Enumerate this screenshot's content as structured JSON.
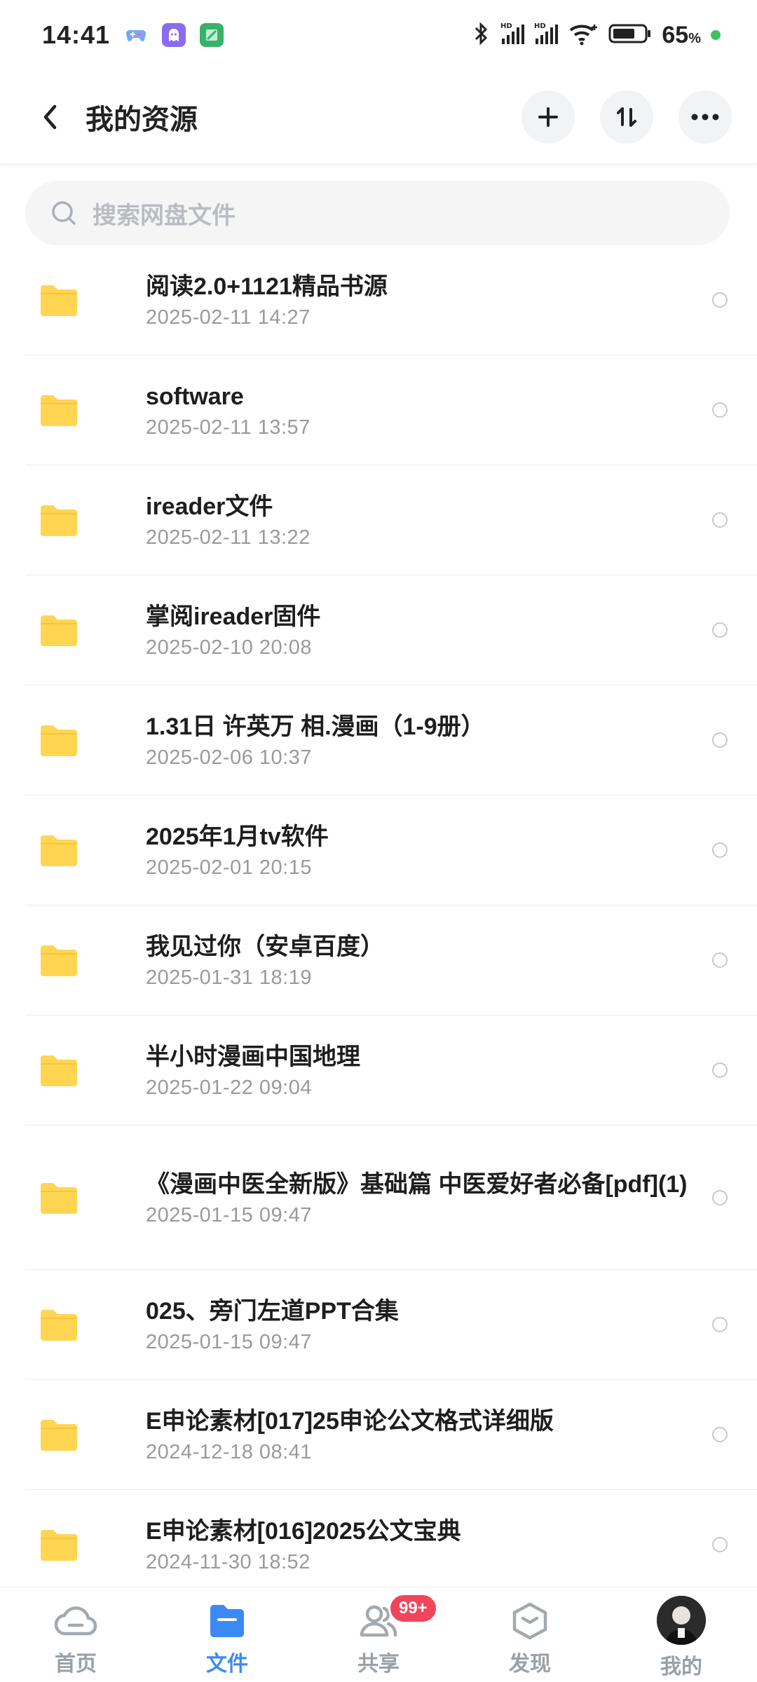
{
  "status_bar": {
    "time": "14:41",
    "battery_percent": "65",
    "battery_unit": "%"
  },
  "header": {
    "title": "我的资源"
  },
  "search": {
    "placeholder": "搜索网盘文件"
  },
  "files": [
    {
      "name": "阅读2.0+1121精品书源",
      "date": "2025-02-11  14:27"
    },
    {
      "name": "software",
      "date": "2025-02-11  13:57"
    },
    {
      "name": "ireader文件",
      "date": "2025-02-11  13:22"
    },
    {
      "name": "掌阅ireader固件",
      "date": "2025-02-10  20:08"
    },
    {
      "name": "1.31日 许英万 相.漫画（1-9册）",
      "date": "2025-02-06  10:37"
    },
    {
      "name": "2025年1月tv软件",
      "date": "2025-02-01  20:15"
    },
    {
      "name": "我见过你（安卓百度）",
      "date": "2025-01-31  18:19"
    },
    {
      "name": "半小时漫画中国地理",
      "date": "2025-01-22  09:04"
    },
    {
      "name": "《漫画中医全新版》基础篇 中医爱好者必备[pdf](1)",
      "date": "2025-01-15  09:47"
    },
    {
      "name": "025、旁门左道PPT合集",
      "date": "2025-01-15  09:47"
    },
    {
      "name": "E申论素材[017]25申论公文格式详细版",
      "date": "2024-12-18  08:41"
    },
    {
      "name": "E申论素材[016]2025公文宝典",
      "date": "2024-11-30  18:52"
    }
  ],
  "bottom_nav": {
    "home": "首页",
    "files": "文件",
    "share": "共享",
    "share_badge": "99+",
    "discover": "发现",
    "mine": "我的"
  },
  "colors": {
    "accent": "#3b8af3",
    "folder": "#ffd552",
    "badge": "#f0455b"
  }
}
